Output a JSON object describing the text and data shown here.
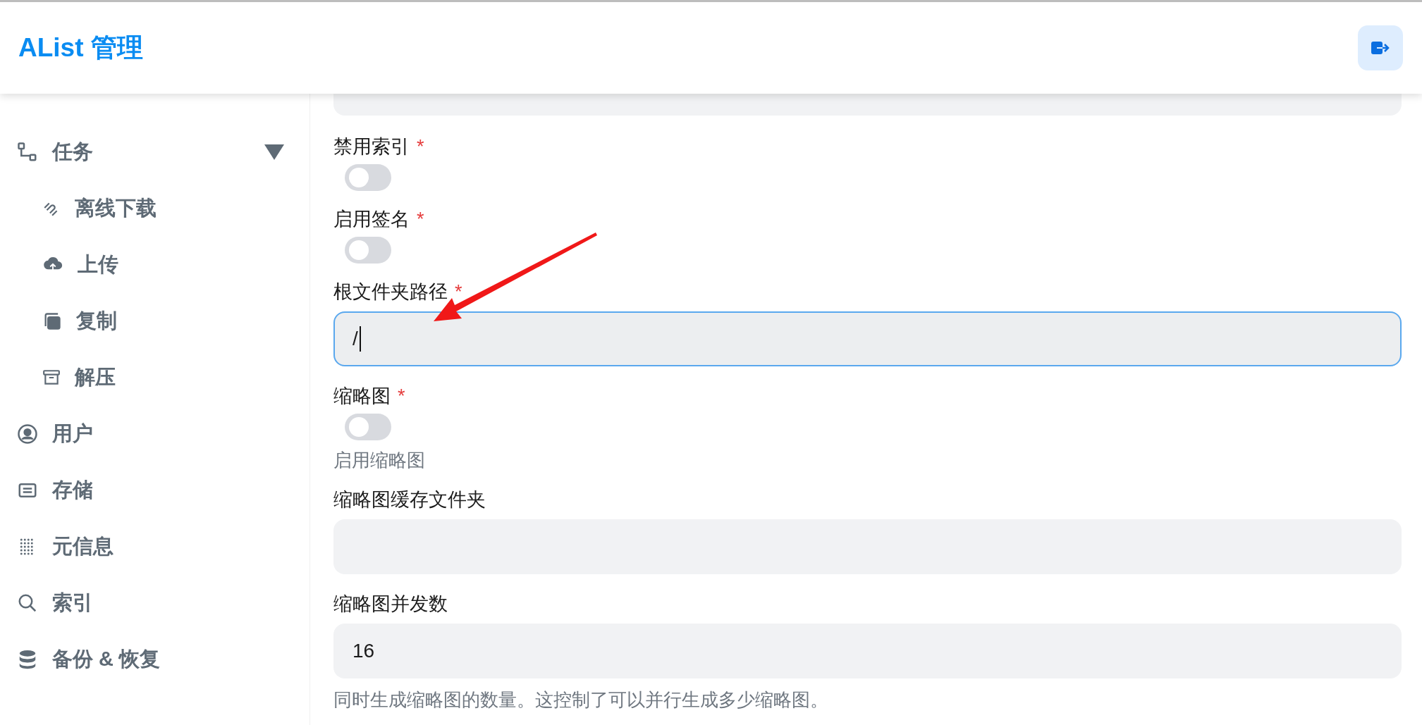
{
  "header": {
    "title": "AList 管理"
  },
  "sidebar": {
    "items": [
      {
        "label": "任务",
        "expanded": true,
        "children": [
          {
            "label": "离线下载"
          },
          {
            "label": "上传"
          },
          {
            "label": "复制"
          },
          {
            "label": "解压"
          }
        ]
      },
      {
        "label": "用户"
      },
      {
        "label": "存储"
      },
      {
        "label": "元信息"
      },
      {
        "label": "索引"
      },
      {
        "label": "备份 & 恢复"
      }
    ]
  },
  "form": {
    "fields": [
      {
        "kind": "switch",
        "label": "禁用索引",
        "mark": "*",
        "on": false
      },
      {
        "kind": "switch",
        "label": "启用签名",
        "mark": "*",
        "on": false
      },
      {
        "kind": "text",
        "label": "根文件夹路径",
        "mark": "*",
        "value": "/",
        "focused": true
      },
      {
        "kind": "switch",
        "label": "缩略图",
        "mark": "*",
        "on": false,
        "help": "启用缩略图"
      },
      {
        "kind": "text",
        "label": "缩略图缓存文件夹",
        "focused": false
      },
      {
        "kind": "text",
        "label": "缩略图并发数",
        "value": "16",
        "focused": false,
        "help": "同时生成缩略图的数量。这控制了可以并行生成多少缩略图。"
      }
    ]
  }
}
